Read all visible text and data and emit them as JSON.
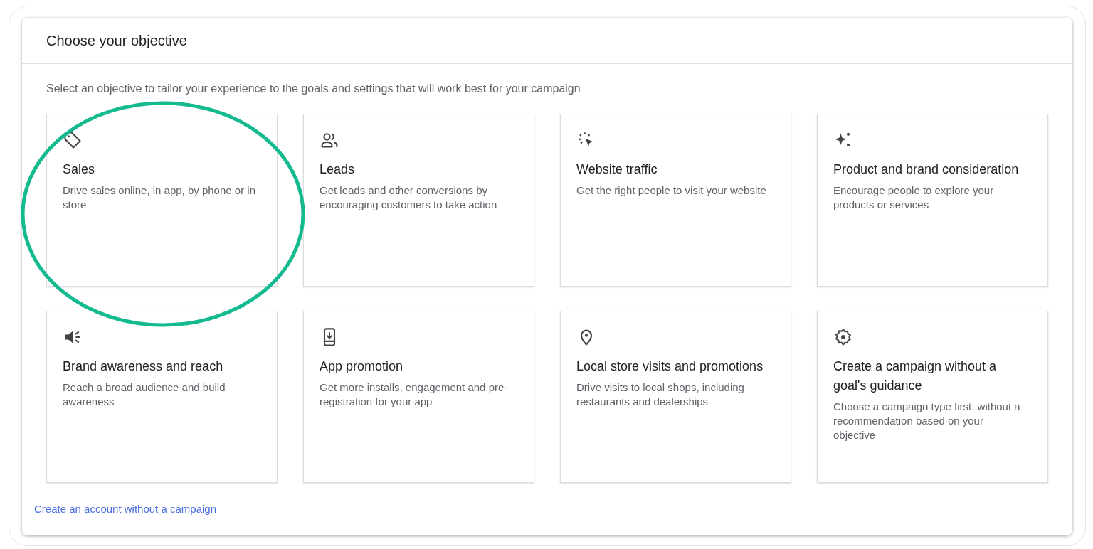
{
  "panel": {
    "title": "Choose your objective",
    "subtitle": "Select an objective to tailor your experience to the goals and settings that will work best for your campaign"
  },
  "objectives": [
    {
      "title": "Sales",
      "description": "Drive sales online, in app, by phone or in store",
      "highlighted": true
    },
    {
      "title": "Leads",
      "description": "Get leads and other conversions by encouraging customers to take action",
      "highlighted": false
    },
    {
      "title": "Website traffic",
      "description": "Get the right people to visit your website",
      "highlighted": false
    },
    {
      "title": "Product and brand consideration",
      "description": "Encourage people to explore your products or services",
      "highlighted": false
    },
    {
      "title": "Brand awareness and reach",
      "description": "Reach a broad audience and build awareness",
      "highlighted": false
    },
    {
      "title": "App promotion",
      "description": "Get more installs, engagement and pre-registration for your app",
      "highlighted": false
    },
    {
      "title": "Local store visits and promotions",
      "description": "Drive visits to local shops, including restaurants and dealerships",
      "highlighted": false
    },
    {
      "title": "Create a campaign without a goal's guidance",
      "description": "Choose a campaign type first, without a recommendation based on your objective",
      "highlighted": false
    }
  ],
  "footer_link": "Create an account without a campaign"
}
